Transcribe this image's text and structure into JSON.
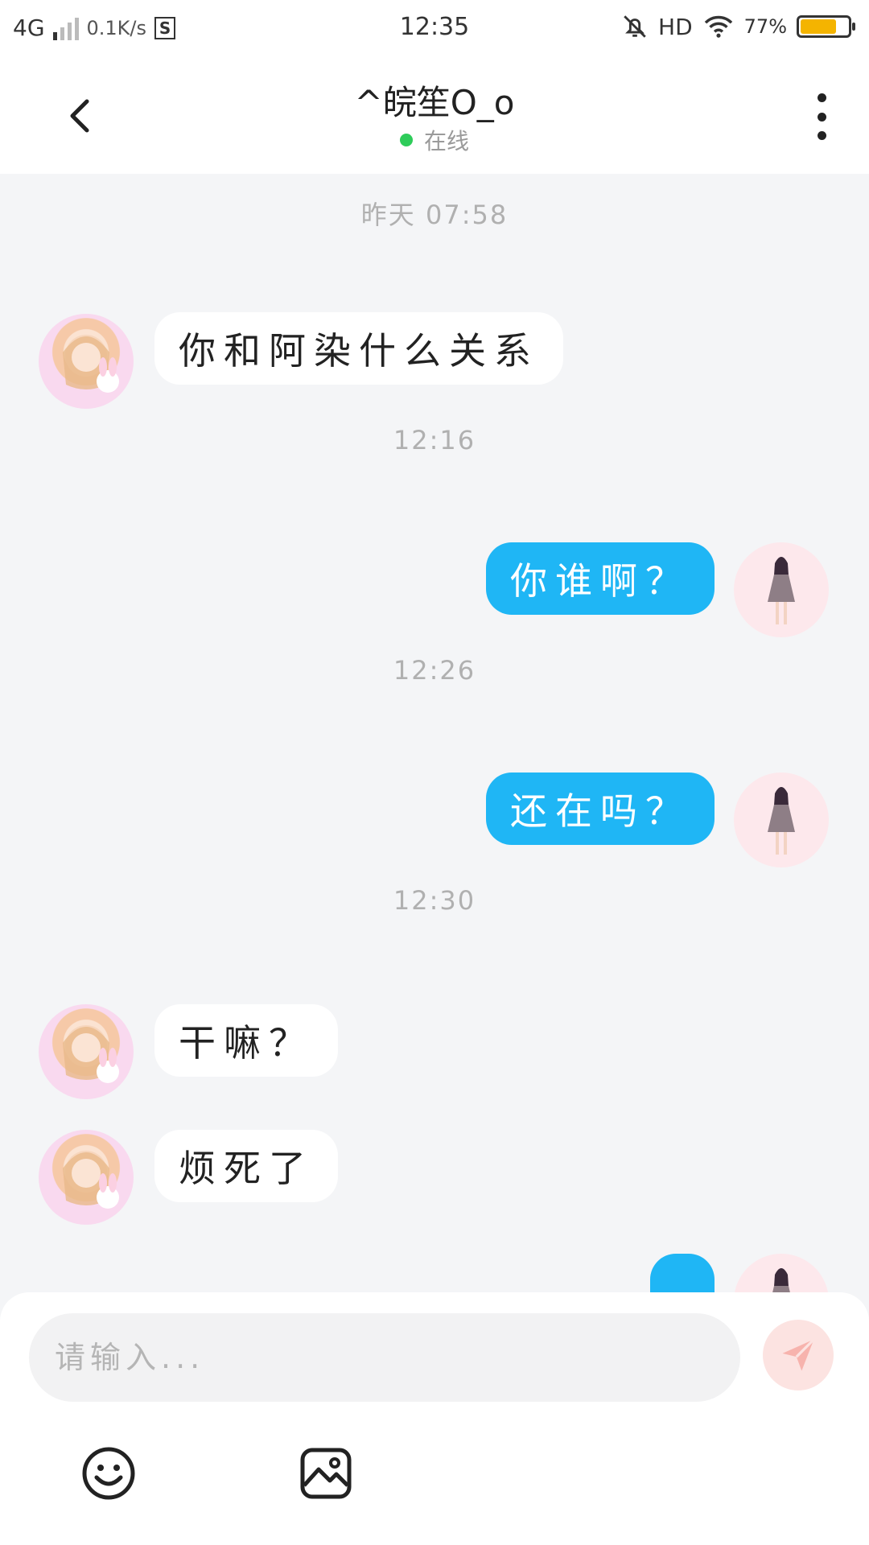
{
  "status_bar": {
    "network": "4G",
    "speed": "0.1K/s",
    "s_icon": "S",
    "time": "12:35",
    "hd": "HD",
    "battery_percent": "77%",
    "battery_level": 0.77
  },
  "header": {
    "title": "^皖笙O_o",
    "status": "在线"
  },
  "messages": [
    {
      "type": "timestamp",
      "text": "昨天 07:58"
    },
    {
      "type": "in",
      "text": "你和阿染什么关系"
    },
    {
      "type": "timestamp",
      "text": "12:16"
    },
    {
      "type": "out",
      "text": "你谁啊？"
    },
    {
      "type": "timestamp",
      "text": "12:26"
    },
    {
      "type": "out",
      "text": "还在吗？"
    },
    {
      "type": "timestamp",
      "text": "12:30"
    },
    {
      "type": "in",
      "text": "干嘛？"
    },
    {
      "type": "in",
      "text": "烦死了"
    },
    {
      "type": "out",
      "text": ""
    }
  ],
  "composer": {
    "placeholder": "请输入...",
    "value": ""
  },
  "colors": {
    "accent": "#1fb6f5",
    "online": "#2ecc5a",
    "battery": "#f4b400",
    "send_button": "#fce3e1"
  },
  "icons": {
    "back": "chevron-left-icon",
    "more": "more-vertical-icon",
    "send": "paper-plane-icon",
    "emoji": "smile-icon",
    "image": "image-icon"
  }
}
